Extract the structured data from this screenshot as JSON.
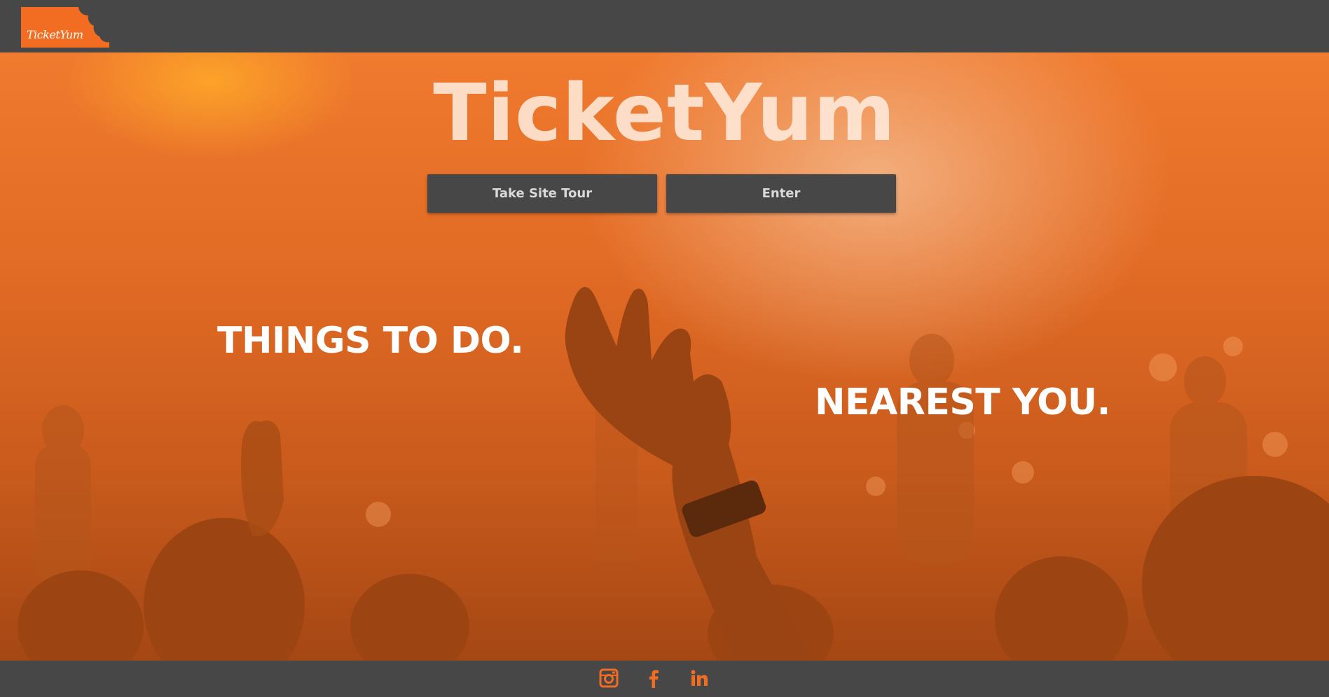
{
  "header": {
    "logo_text": "TicketYum",
    "logo_color": "#f26d21"
  },
  "hero": {
    "title": "TicketYum",
    "buttons": {
      "tour_label": "Take Site Tour",
      "enter_label": "Enter"
    },
    "tagline_left": "THINGS TO DO.",
    "tagline_right": "NEAREST YOU."
  },
  "footer": {
    "social_icons": [
      "instagram-icon",
      "facebook-icon",
      "linkedin-icon"
    ],
    "icon_color": "#f26d21"
  },
  "colors": {
    "bar_background": "#474747",
    "accent": "#f26d21",
    "button_text": "#d9d9d9"
  }
}
